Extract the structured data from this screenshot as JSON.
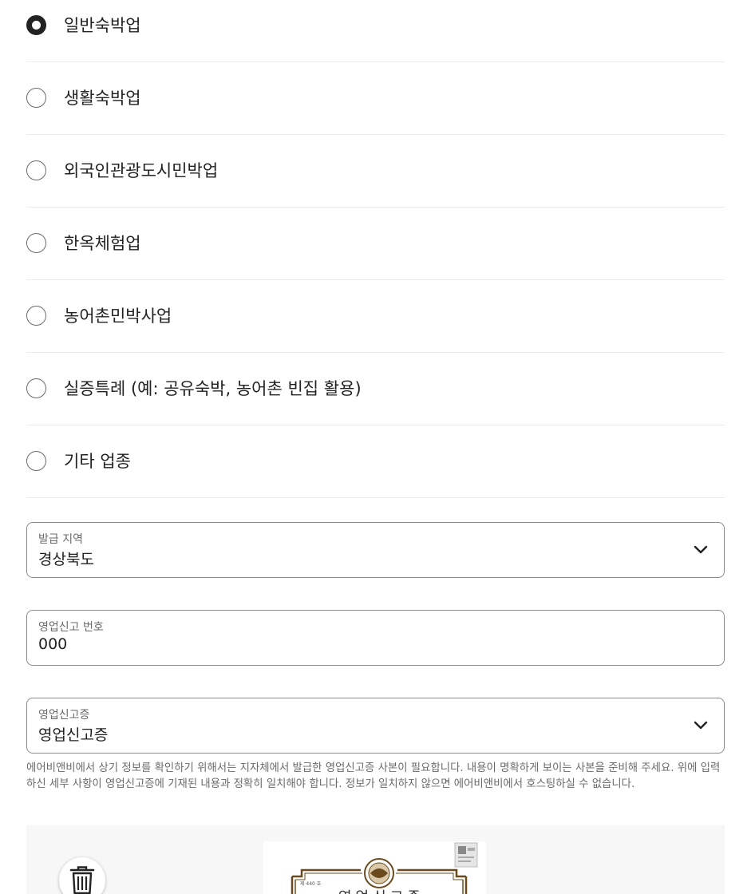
{
  "business_types": [
    {
      "label": "일반숙박업",
      "selected": true
    },
    {
      "label": "생활숙박업",
      "selected": false
    },
    {
      "label": "외국인관광도시민박업",
      "selected": false
    },
    {
      "label": "한옥체험업",
      "selected": false
    },
    {
      "label": "농어촌민박사업",
      "selected": false
    },
    {
      "label": "실증특례 (예: 공유숙박, 농어촌 빈집 활용)",
      "selected": false
    },
    {
      "label": "기타 업종",
      "selected": false
    }
  ],
  "region_select": {
    "label": "발급 지역",
    "value": "경상북도"
  },
  "license_number": {
    "label": "영업신고 번호",
    "value": "000"
  },
  "document_select": {
    "label": "영업신고증",
    "value": "영업신고증"
  },
  "help_text": "에어비앤비에서 상기 정보를 확인하기 위해서는 지자체에서 발급한 영업신고증 사본이 필요합니다. 내용이 명확하게 보이는 사본을 준비해 주세요. 위에 입력하신 세부 사항이 영업신고증에 기재된 내용과 정확히 일치해야 합니다. 정보가 일치하지 않으면 에어비앤비에서 호스팅하실 수 없습니다.",
  "upload": {
    "delete_icon": "trash-icon",
    "certificate_number": "제 440 호",
    "certificate_title": "영업신고증"
  },
  "colors": {
    "text": "#222222",
    "muted": "#6a6a6a",
    "divider": "#ebebeb",
    "border": "#8a8a8a",
    "upload_bg": "#f7f7f7",
    "certificate_border": "#6b4a1e"
  }
}
